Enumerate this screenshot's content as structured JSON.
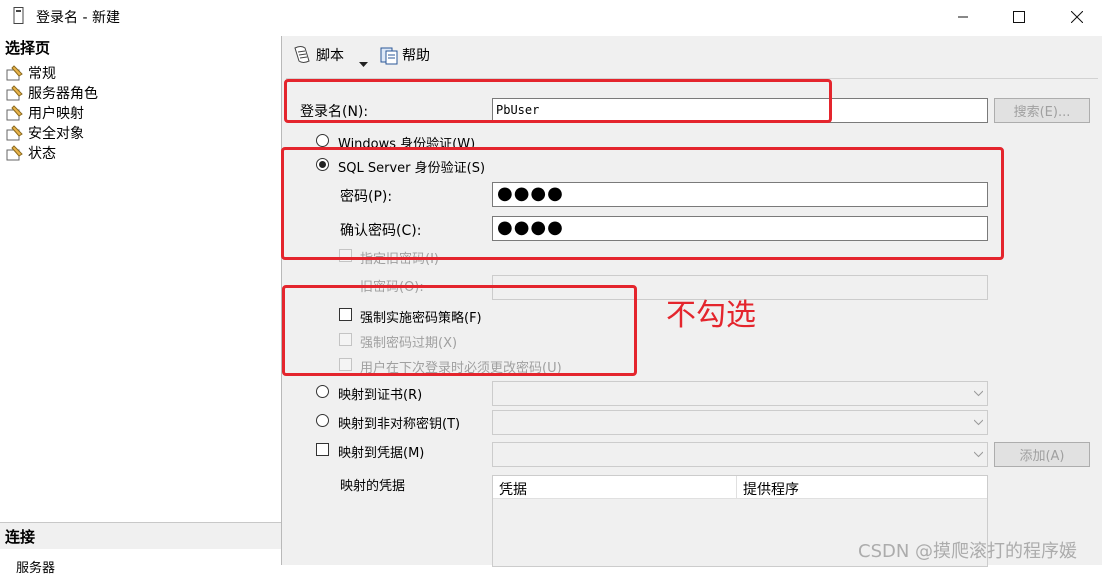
{
  "window": {
    "title": "登录名 - 新建"
  },
  "left_panel": {
    "select_page_title": "选择页",
    "items": [
      "常规",
      "服务器角色",
      "用户映射",
      "安全对象",
      "状态"
    ],
    "connection_title": "连接",
    "server_label": "服务器"
  },
  "toolbar": {
    "script_label": "脚本",
    "help_label": "帮助"
  },
  "form": {
    "login_name_label": "登录名(N):",
    "login_name_value": "PbUser",
    "search_button": "搜索(E)...",
    "windows_auth_label": "Windows 身份验证(W)",
    "sql_auth_label": "SQL Server 身份验证(S)",
    "password_label": "密码(P):",
    "password_value": "●●●●",
    "confirm_password_label": "确认密码(C):",
    "confirm_password_value": "●●●●",
    "specify_old_password_label": "指定旧密码(I)",
    "old_password_label": "旧密码(O):",
    "enforce_policy_label": "强制实施密码策略(F)",
    "enforce_expiration_label": "强制密码过期(X)",
    "must_change_label": "用户在下次登录时必须更改密码(U)",
    "map_certificate_label": "映射到证书(R)",
    "map_asym_key_label": "映射到非对称密钥(T)",
    "map_credential_label": "映射到凭据(M)",
    "add_button": "添加(A)",
    "mapped_credentials_label": "映射的凭据",
    "cred_table_columns": [
      "凭据",
      "提供程序"
    ]
  },
  "annotation": {
    "text": "不勾选",
    "color": "#e4252d"
  },
  "watermark": "CSDN @摸爬滚打的程序媛",
  "colors": {
    "highlight_red": "#e4252d",
    "panel_bg": "#f0f0f0"
  }
}
